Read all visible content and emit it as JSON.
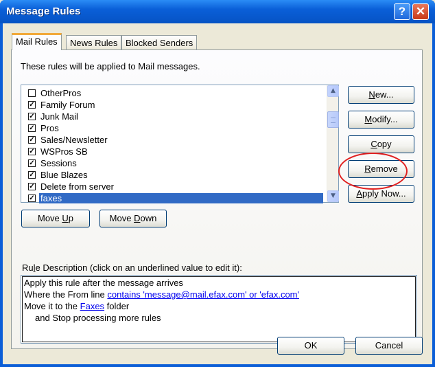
{
  "window": {
    "title": "Message Rules",
    "help_glyph": "?",
    "close_glyph": "✕"
  },
  "tabs": [
    {
      "label": "Mail Rules",
      "active": true
    },
    {
      "label": "News Rules",
      "active": false
    },
    {
      "label": "Blocked Senders",
      "active": false
    }
  ],
  "mail_rules": {
    "info_text": "These rules will be applied to Mail messages.",
    "rules": [
      {
        "name": "OtherPros",
        "checked": false
      },
      {
        "name": "Family Forum",
        "checked": true
      },
      {
        "name": "Junk Mail",
        "checked": true
      },
      {
        "name": "Pros",
        "checked": true
      },
      {
        "name": "Sales/Newsletter",
        "checked": true
      },
      {
        "name": "WSPros SB",
        "checked": true
      },
      {
        "name": "Sessions",
        "checked": true
      },
      {
        "name": "Blue Blazes",
        "checked": true
      },
      {
        "name": "Delete from server",
        "checked": true
      },
      {
        "name": "faxes",
        "checked": true,
        "selected": true
      }
    ],
    "buttons": {
      "new": {
        "pre": "",
        "key": "N",
        "post": "ew..."
      },
      "modify": {
        "pre": "",
        "key": "M",
        "post": "odify..."
      },
      "copy": {
        "pre": "",
        "key": "C",
        "post": "opy"
      },
      "remove": {
        "pre": "",
        "key": "R",
        "post": "emove"
      },
      "apply_now": {
        "pre": "",
        "key": "A",
        "post": "pply Now..."
      },
      "move_up": {
        "pre": "Move ",
        "key": "U",
        "post": "p"
      },
      "move_down": {
        "pre": "Move ",
        "key": "D",
        "post": "own"
      }
    },
    "description_label": {
      "pre": "Ru",
      "key": "l",
      "post": "e Description (click on an underlined value to edit it):"
    },
    "description": {
      "line1": "Apply this rule after the message arrives",
      "line2_pre": "Where the From line ",
      "line2_link": "contains 'message@mail.efax.com' or 'efax.com'",
      "line3_pre": "Move it to the ",
      "line3_link": "Faxes",
      "line3_post": " folder",
      "line4": "and Stop processing more rules"
    }
  },
  "footer": {
    "ok_label": "OK",
    "cancel_label": "Cancel"
  },
  "colors": {
    "titlebar": "#0a5fd8",
    "selection": "#316ac5",
    "highlight_circle": "#e01f1f"
  }
}
